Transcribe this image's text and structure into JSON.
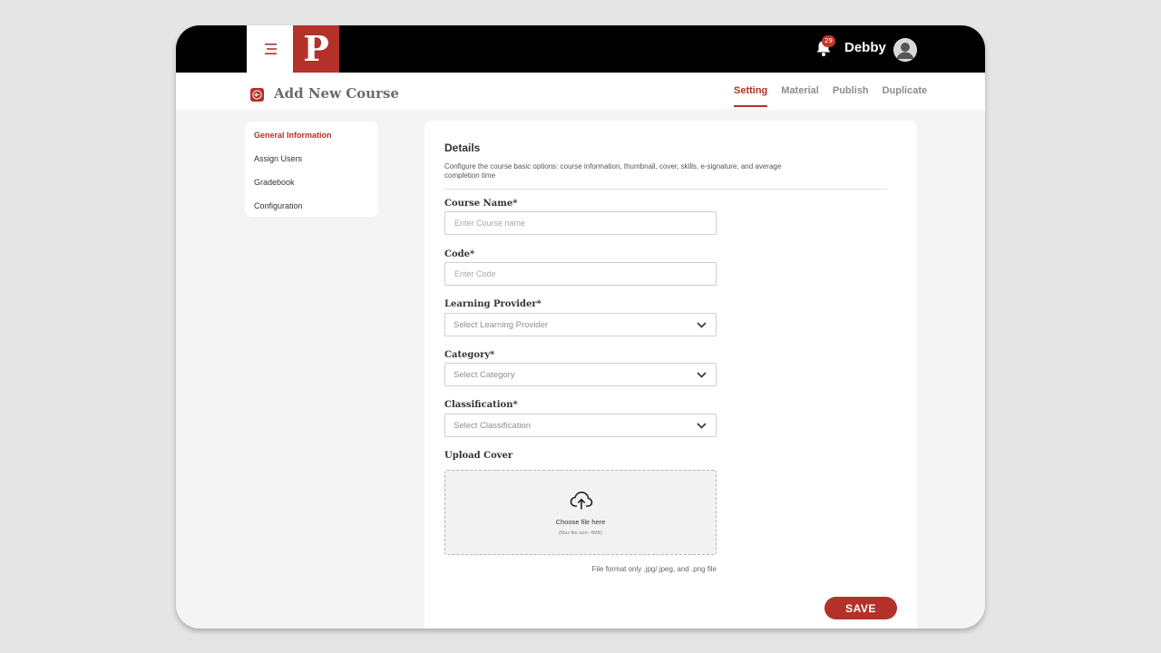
{
  "app": {
    "logo_letter": "P",
    "notifications_count": "29",
    "username": "Debby"
  },
  "header": {
    "title": "Add New Course",
    "tabs": [
      {
        "label": "Setting",
        "active": true
      },
      {
        "label": "Material",
        "active": false
      },
      {
        "label": "Publish",
        "active": false
      },
      {
        "label": "Duplicate",
        "active": false
      }
    ]
  },
  "sidebar": {
    "items": [
      {
        "label": "General Information",
        "active": true
      },
      {
        "label": "Assign Users",
        "active": false
      },
      {
        "label": "Gradebook",
        "active": false
      },
      {
        "label": "Configuration",
        "active": false
      }
    ]
  },
  "details": {
    "title": "Details",
    "description": "Configure the course basic options: course information, thumbnail, cover, skills, e-signature, and average completion time"
  },
  "form": {
    "course_name": {
      "label": "Course Name*",
      "placeholder": "Enter Course name",
      "value": ""
    },
    "code": {
      "label": "Code*",
      "placeholder": "Enter Code",
      "value": ""
    },
    "learning_provider": {
      "label": "Learning Provider*",
      "selected": "Select Learning Provider"
    },
    "category": {
      "label": "Category*",
      "selected": "Select Category"
    },
    "classification": {
      "label": "Classification*",
      "selected": "Select Classification"
    },
    "upload_cover": {
      "label": "Upload Cover",
      "prompt": "Choose file here",
      "max_size": "(Max file size: 4MB)",
      "format_note": "File format only .jpg/.jpeg, and .png file"
    }
  },
  "actions": {
    "save_label": "SAVE"
  },
  "colors": {
    "accent": "#b33129",
    "topbar": "#000000",
    "background": "#f4f4f4"
  },
  "icons": [
    "hamburger-menu-icon",
    "bell-icon",
    "user-avatar-icon",
    "arrow-left-icon",
    "chevron-down-icon",
    "cloud-upload-icon"
  ]
}
